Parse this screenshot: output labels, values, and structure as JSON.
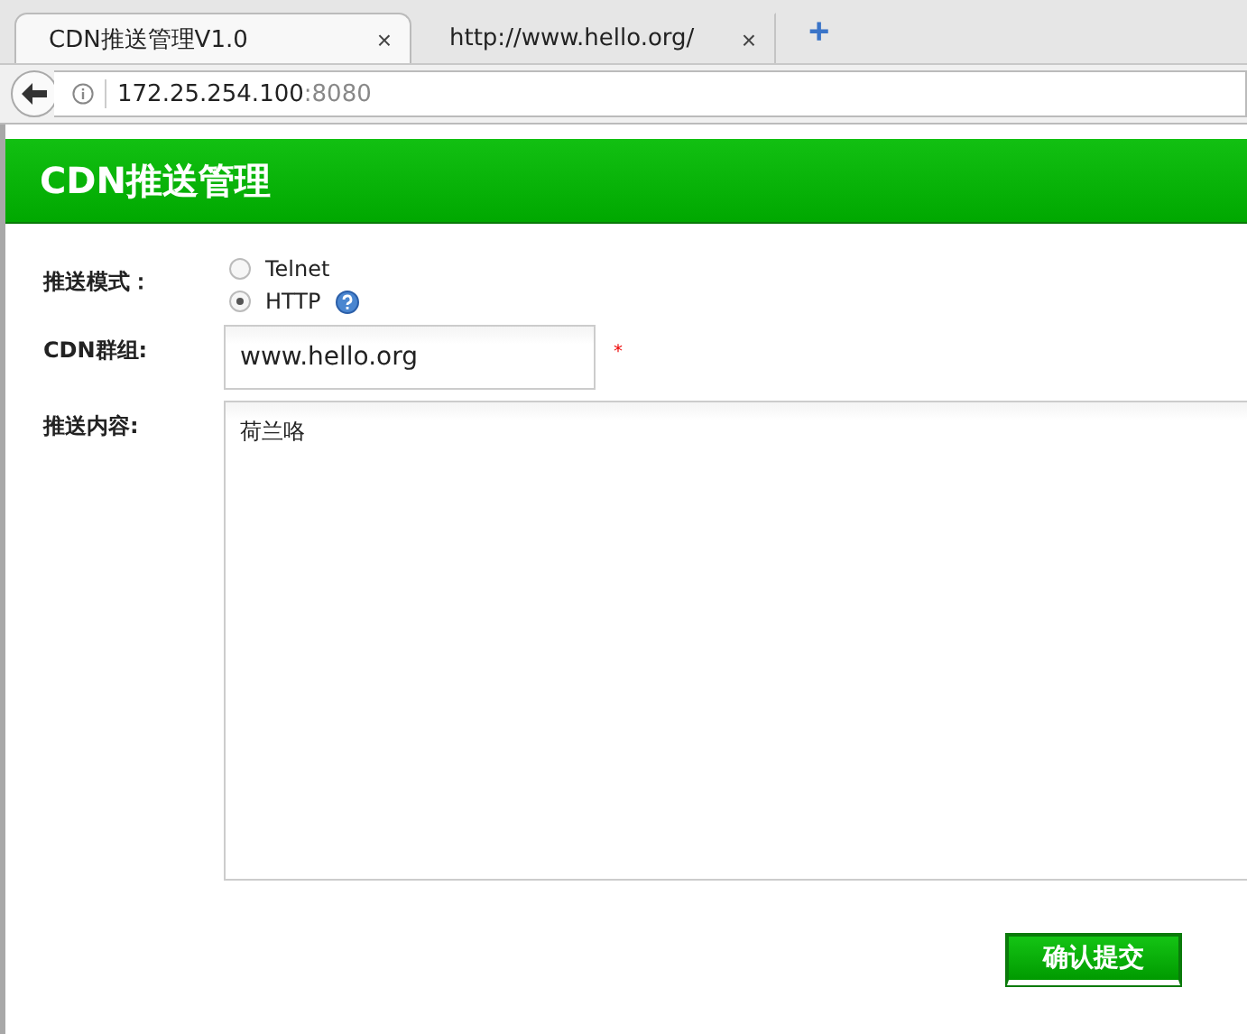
{
  "browser": {
    "tabs": [
      {
        "title": "CDN推送管理V1.0",
        "close": "×",
        "selected": true
      },
      {
        "title": "http://www.hello.org/",
        "close": "×",
        "selected": false
      }
    ],
    "new_tab": "+",
    "address": {
      "host": "172.25.254.100",
      "port": ":8080"
    }
  },
  "header": {
    "title": "CDN推送管理"
  },
  "form": {
    "mode": {
      "label": "推送模式：",
      "options": [
        {
          "label": "Telnet",
          "selected": false,
          "help": false
        },
        {
          "label": "HTTP",
          "selected": true,
          "help": true
        }
      ]
    },
    "group": {
      "label": "CDN群组:",
      "value": "www.hello.org",
      "required": "*"
    },
    "content": {
      "label": "推送内容:",
      "value": "荷兰咯"
    },
    "submit": "确认提交"
  }
}
